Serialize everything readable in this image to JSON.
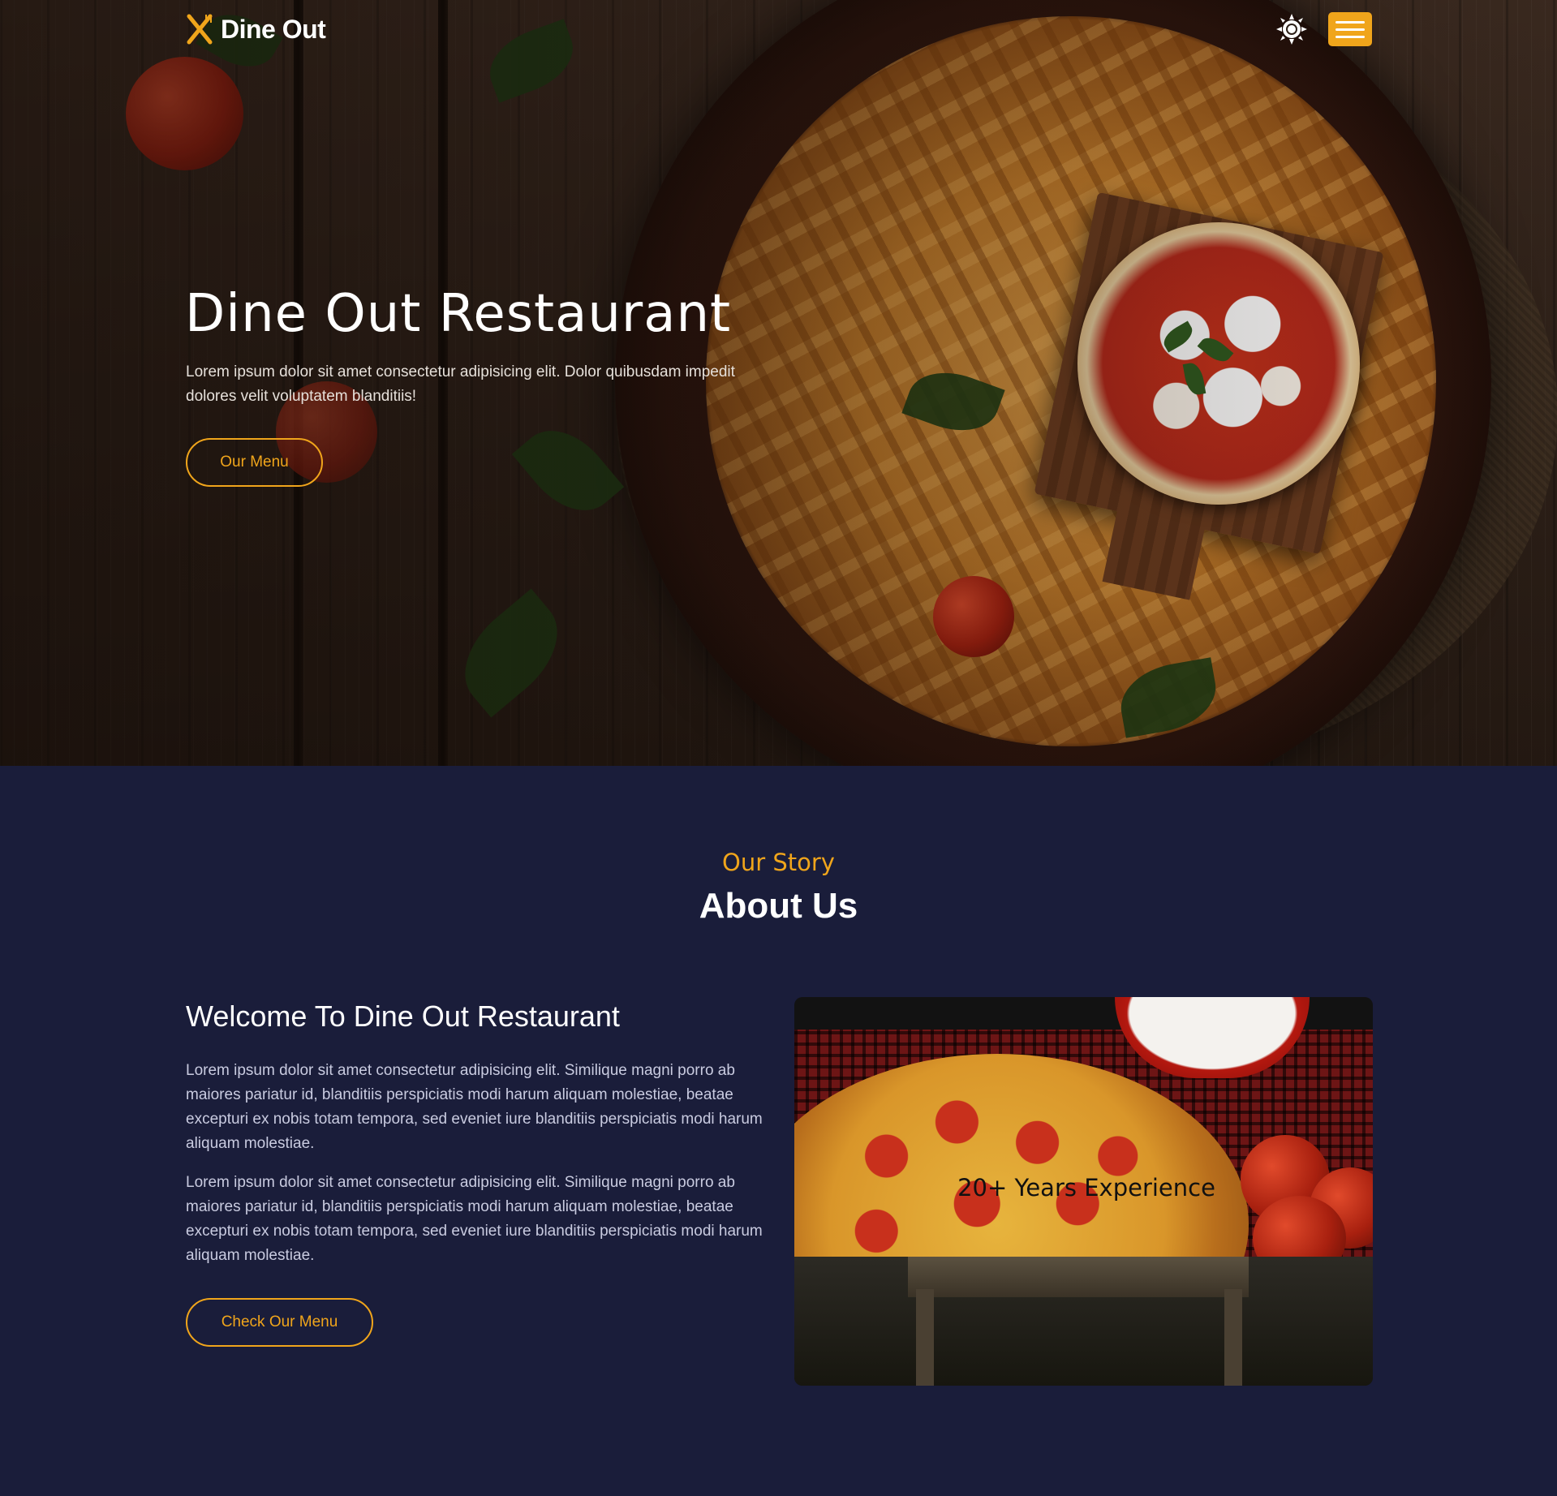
{
  "nav": {
    "logo_text": "Dine Out",
    "theme_toggle_icon": "sun-icon",
    "menu_icon": "hamburger-menu-icon",
    "accent_color": "#f0a51b"
  },
  "hero": {
    "title": "Dine Out Restaurant",
    "description": "Lorem ipsum dolor sit amet consectetur adipisicing elit. Dolor quibusdam impedit dolores velit voluptatem blanditiis!",
    "cta_label": "Our Menu"
  },
  "about": {
    "eyebrow": "Our Story",
    "title": "About Us",
    "heading": "Welcome To Dine Out Restaurant",
    "paragraph_1": "Lorem ipsum dolor sit amet consectetur adipisicing elit. Similique magni porro ab maiores pariatur id, blanditiis perspiciatis modi harum aliquam molestiae, beatae excepturi ex nobis totam tempora, sed eveniet iure blanditiis perspiciatis modi harum aliquam molestiae.",
    "paragraph_2": "Lorem ipsum dolor sit amet consectetur adipisicing elit. Similique magni porro ab maiores pariatur id, blanditiis perspiciatis modi harum aliquam molestiae, beatae excepturi ex nobis totam tempora, sed eveniet iure blanditiis perspiciatis modi harum aliquam molestiae.",
    "cta_label": "Check Our Menu",
    "image_caption": "20+ Years Experience"
  },
  "colors": {
    "background": "#1a1d3a",
    "accent": "#f0a51b"
  }
}
